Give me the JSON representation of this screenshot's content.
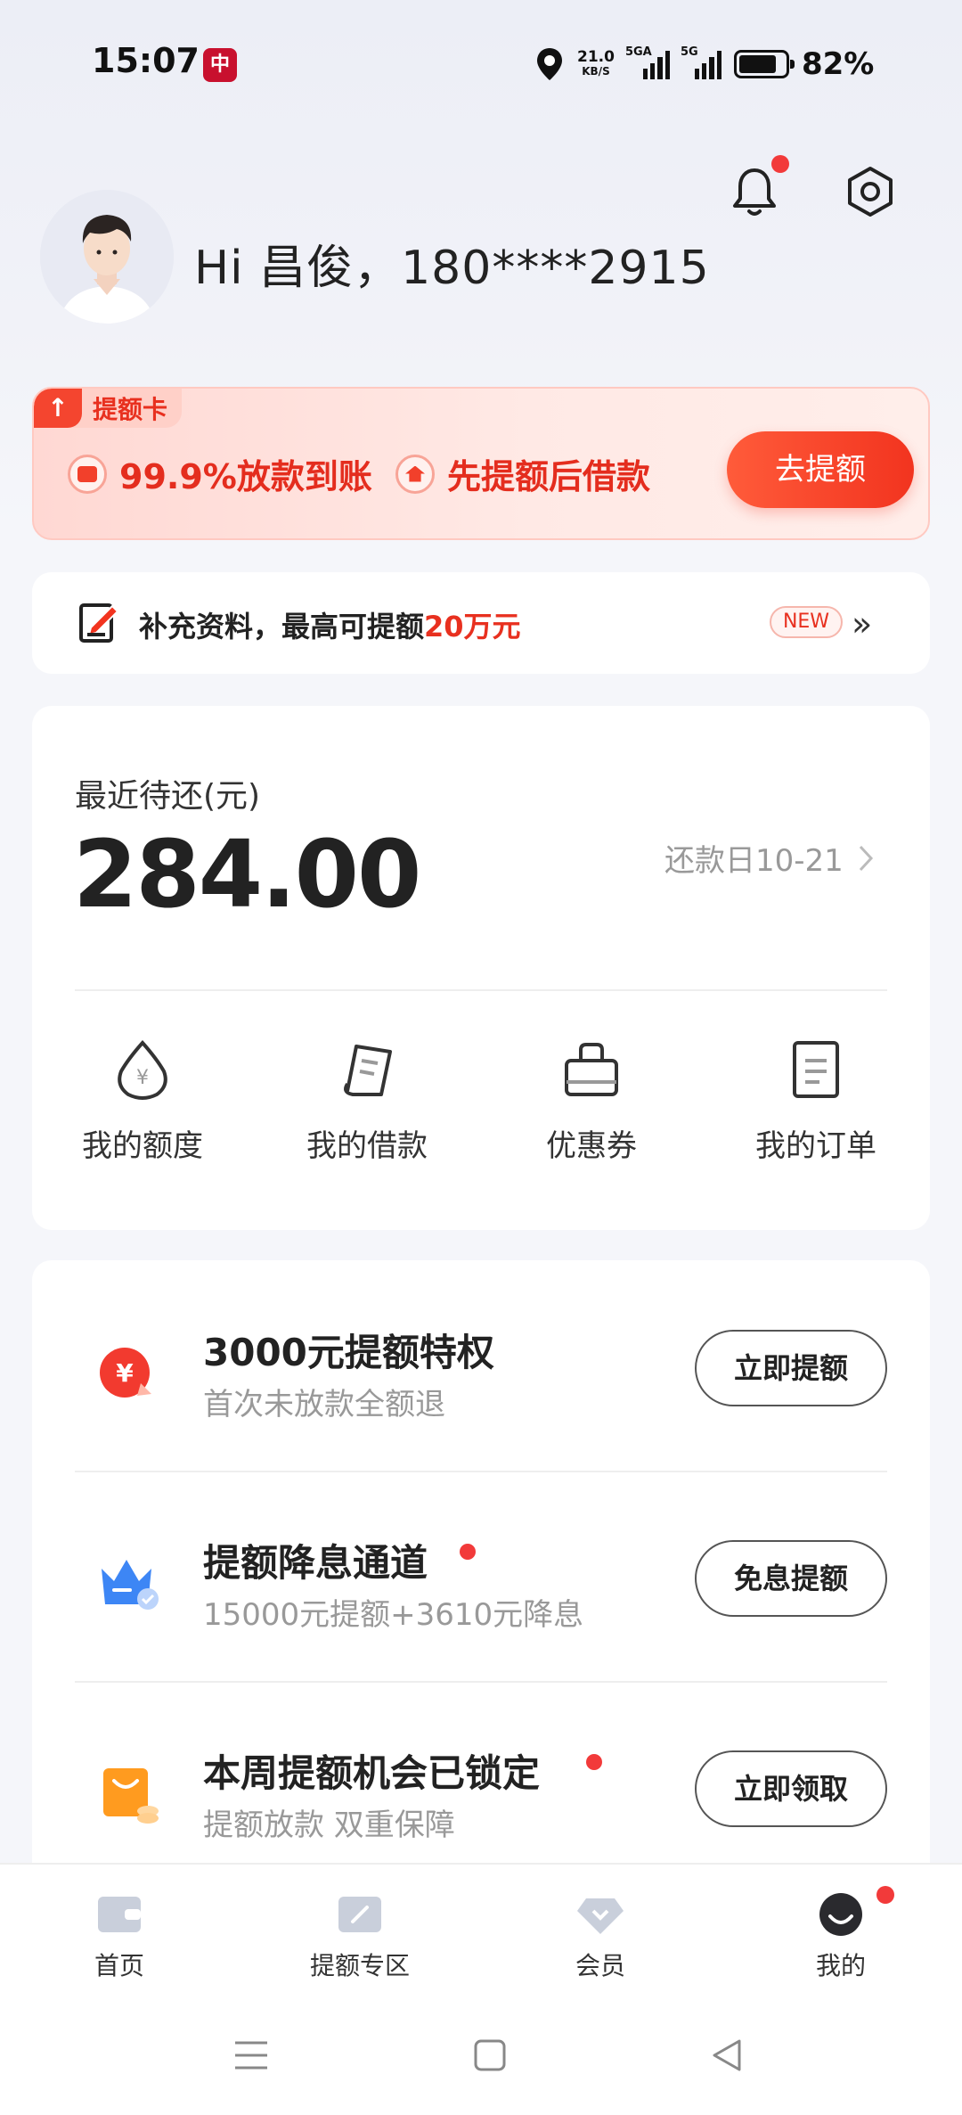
{
  "status_bar": {
    "time": "15:07",
    "app_icon_glyph": "中",
    "speed_value": "21.0",
    "speed_unit": "KB/S",
    "signal1_tag": "5GA",
    "signal2_tag": "5G",
    "battery_percent": "82%",
    "battery_level": 0.82
  },
  "header": {
    "greeting": "Hi 昌俊，180****2915",
    "has_notification": true
  },
  "promo": {
    "tag_label": "提额卡",
    "feature1": "99.9%放款到账",
    "feature2": "先提额后借款",
    "button_label": "去提额"
  },
  "supplement": {
    "text_prefix": "补充资料，最高可提额",
    "text_highlight": "20万元",
    "badge": "NEW",
    "chevron": "»"
  },
  "repayment": {
    "label": "最近待还(元)",
    "amount": "284.00",
    "due_date": "还款日10-21"
  },
  "quick_actions": [
    {
      "label": "我的额度",
      "icon": "money-drop-icon"
    },
    {
      "label": "我的借款",
      "icon": "receipt-icon"
    },
    {
      "label": "优惠券",
      "icon": "bag-icon"
    },
    {
      "label": "我的订单",
      "icon": "order-icon"
    }
  ],
  "tasks": [
    {
      "title": "3000元提额特权",
      "subtitle": "首次未放款全额退",
      "button": "立即提额",
      "icon": "yuan-coin-icon",
      "dot": false
    },
    {
      "title": "提额降息通道",
      "subtitle": "15000元提额+3610元降息",
      "button": "免息提额",
      "icon": "crown-icon",
      "dot": true
    },
    {
      "title": "本周提额机会已锁定",
      "subtitle": "提额放款 双重保障",
      "button": "立即领取",
      "icon": "gift-bag-icon",
      "dot": true
    }
  ],
  "bottom_nav": [
    {
      "label": "首页",
      "icon": "wallet-icon"
    },
    {
      "label": "提额专区",
      "icon": "boost-zone-icon"
    },
    {
      "label": "会员",
      "icon": "diamond-icon"
    },
    {
      "label": "我的",
      "icon": "profile-face-icon"
    }
  ],
  "colors": {
    "accent_red": "#f2341f",
    "text_primary": "#222222",
    "text_secondary": "#999999",
    "background": "#f5f6fa"
  }
}
